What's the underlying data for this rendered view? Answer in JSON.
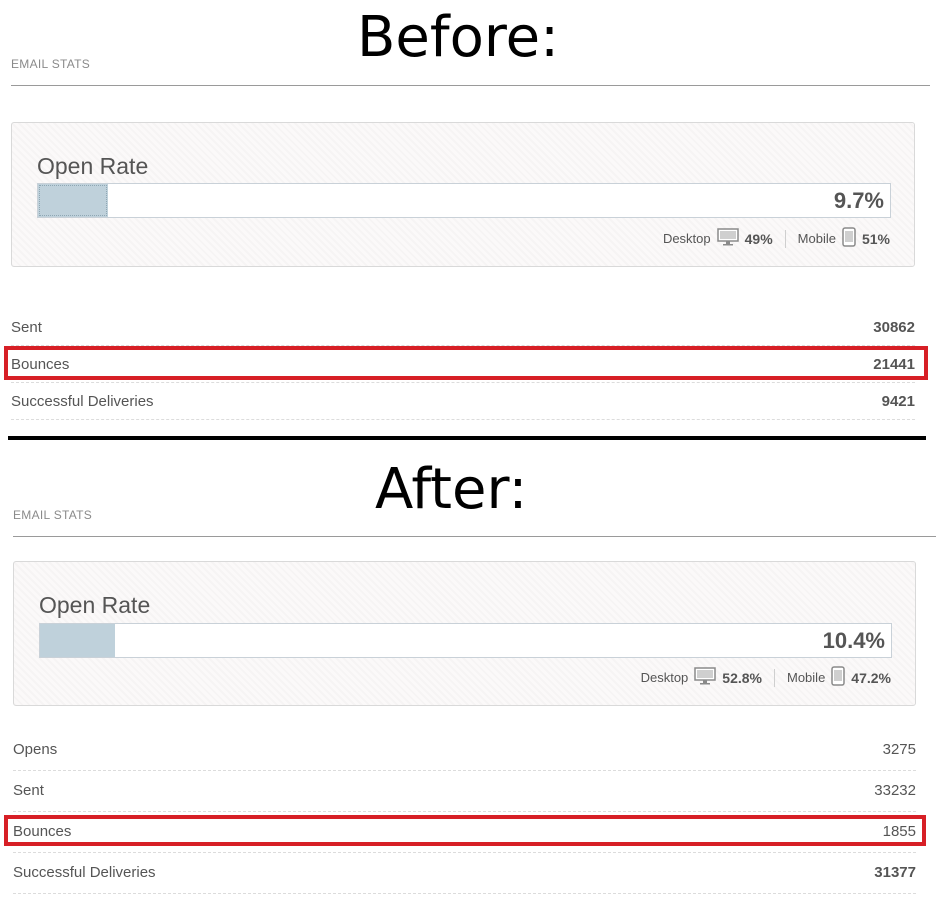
{
  "before": {
    "heading": "Before:",
    "section_label": "EMAIL STATS",
    "card": {
      "title": "Open Rate",
      "rate_value": "9.7%",
      "rate_fraction": 0.097,
      "desktop_label": "Desktop",
      "desktop_value": "49%",
      "mobile_label": "Mobile",
      "mobile_value": "51%"
    },
    "stats": [
      {
        "label": "Sent",
        "value": "30862"
      },
      {
        "label": "Bounces",
        "value": "21441",
        "highlighted": true
      },
      {
        "label": "Successful Deliveries",
        "value": "9421"
      }
    ]
  },
  "after": {
    "heading": "After:",
    "section_label": "EMAIL STATS",
    "card": {
      "title": "Open Rate",
      "rate_value": "10.4%",
      "rate_fraction": 0.104,
      "desktop_label": "Desktop",
      "desktop_value": "52.8%",
      "mobile_label": "Mobile",
      "mobile_value": "47.2%"
    },
    "stats": [
      {
        "label": "Opens",
        "value": "3275"
      },
      {
        "label": "Sent",
        "value": "33232"
      },
      {
        "label": "Bounces",
        "value": "1855",
        "highlighted": true
      },
      {
        "label": "Successful Deliveries",
        "value": "31377"
      }
    ]
  },
  "colors": {
    "highlight": "#d71f26",
    "bar_fill": "#bfd1db"
  },
  "icons": {
    "desktop": "desktop-monitor-icon",
    "mobile": "mobile-phone-icon"
  }
}
